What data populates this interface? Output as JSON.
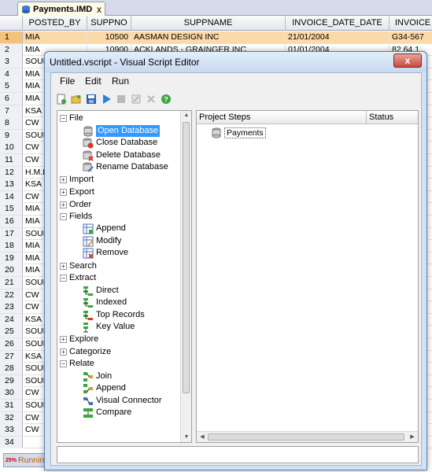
{
  "document_tab": {
    "title": "Payments.IMD",
    "close": "x"
  },
  "grid": {
    "columns": [
      "POSTED_BY",
      "SUPPNO",
      "SUPPNAME",
      "INVOICE_DATE_DATE",
      "INVOICE"
    ],
    "rows": [
      {
        "n": "1",
        "posted_by": "MIA",
        "suppno": "10500",
        "suppname": "AASMAN DESIGN INC",
        "date": "21/01/2004",
        "invoice": "G34-567"
      },
      {
        "n": "2",
        "posted_by": "MIA",
        "suppno": "10900",
        "suppname": "ACKLANDS - GRAINGER INC",
        "date": "01/01/2004",
        "invoice": "82 64 1"
      },
      {
        "n": "3",
        "posted_by": "SOUE"
      },
      {
        "n": "4",
        "posted_by": "MIA"
      },
      {
        "n": "5",
        "posted_by": "MIA"
      },
      {
        "n": "6",
        "posted_by": "MIA"
      },
      {
        "n": "7",
        "posted_by": "KSA"
      },
      {
        "n": "8",
        "posted_by": "CW"
      },
      {
        "n": "9",
        "posted_by": "SOUE"
      },
      {
        "n": "10",
        "posted_by": "CW"
      },
      {
        "n": "11",
        "posted_by": "CW"
      },
      {
        "n": "12",
        "posted_by": "H.M.I"
      },
      {
        "n": "13",
        "posted_by": "KSA"
      },
      {
        "n": "14",
        "posted_by": "CW"
      },
      {
        "n": "15",
        "posted_by": "MIA"
      },
      {
        "n": "16",
        "posted_by": "MIA"
      },
      {
        "n": "17",
        "posted_by": "SOUE"
      },
      {
        "n": "18",
        "posted_by": "MIA"
      },
      {
        "n": "19",
        "posted_by": "MIA"
      },
      {
        "n": "20",
        "posted_by": "MIA"
      },
      {
        "n": "21",
        "posted_by": "SOUE"
      },
      {
        "n": "22",
        "posted_by": "CW"
      },
      {
        "n": "23",
        "posted_by": "CW"
      },
      {
        "n": "24",
        "posted_by": "KSA"
      },
      {
        "n": "25",
        "posted_by": "SOUE"
      },
      {
        "n": "26",
        "posted_by": "SOUE"
      },
      {
        "n": "27",
        "posted_by": "KSA"
      },
      {
        "n": "28",
        "posted_by": "SOUE"
      },
      {
        "n": "29",
        "posted_by": "SOUE"
      },
      {
        "n": "30",
        "posted_by": "CW"
      },
      {
        "n": "31",
        "posted_by": "SOUE"
      },
      {
        "n": "32",
        "posted_by": "CW"
      },
      {
        "n": "33",
        "posted_by": "CW"
      },
      {
        "n": "34",
        "posted_by": ""
      }
    ]
  },
  "bottom_tab": {
    "label": "Runnin",
    "badge": "25%"
  },
  "dialog": {
    "title": "Untitled.vscript - Visual Script Editor",
    "close": "x",
    "menu": [
      "File",
      "Edit",
      "Run"
    ],
    "toolbar_icons": [
      "new-script-icon",
      "open-folder-icon",
      "save-icon",
      "run-icon",
      "stop-icon",
      "edit-icon",
      "delete-icon",
      "help-icon"
    ],
    "tree": {
      "file": {
        "label": "File",
        "children": [
          "Open Database",
          "Close Database",
          "Delete Database",
          "Rename Database"
        ]
      },
      "import": "Import",
      "export": "Export",
      "order": "Order",
      "fields": {
        "label": "Fields",
        "children": [
          "Append",
          "Modify",
          "Remove"
        ]
      },
      "search": "Search",
      "extract": {
        "label": "Extract",
        "children": [
          "Direct",
          "Indexed",
          "Top Records",
          "Key Value"
        ]
      },
      "explore": "Explore",
      "categorize": "Categorize",
      "relate": {
        "label": "Relate",
        "children": [
          "Join",
          "Append",
          "Visual Connector",
          "Compare"
        ]
      }
    },
    "steps": {
      "col_project_steps": "Project Steps",
      "col_status": "Status",
      "items": [
        "Payments"
      ]
    }
  }
}
